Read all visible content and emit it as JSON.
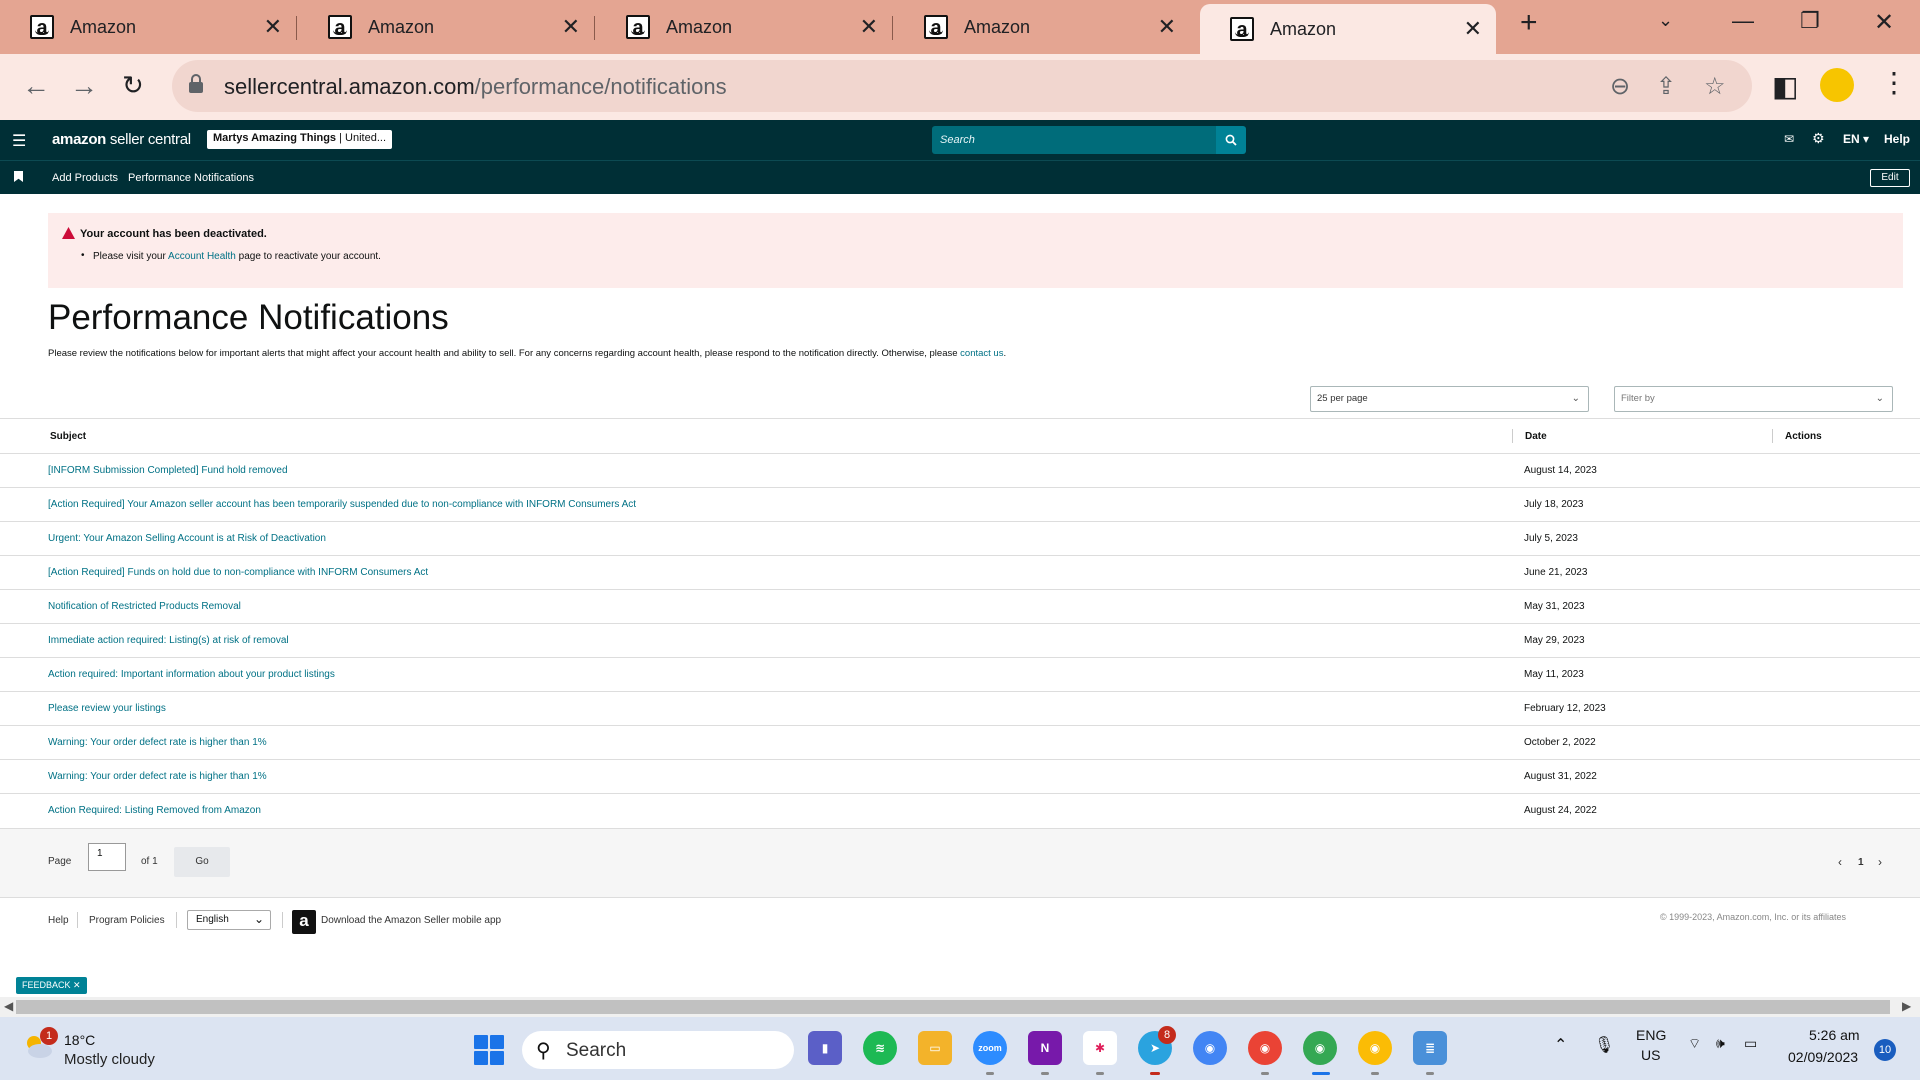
{
  "browser": {
    "tabs": [
      {
        "title": "Amazon",
        "close": "✕"
      },
      {
        "title": "Amazon",
        "close": "✕"
      },
      {
        "title": "Amazon",
        "close": "✕"
      },
      {
        "title": "Amazon",
        "close": "✕"
      },
      {
        "title": "Amazon",
        "close": "✕"
      }
    ],
    "new_tab": "+",
    "url_domain": "sellercentral.amazon.com",
    "url_path": "/performance/notifications"
  },
  "header": {
    "logo_bold": "amazon",
    "logo_rest": " seller central",
    "store_name": "Martys Amazing Things",
    "store_region": " | United...",
    "search_placeholder": "Search",
    "language": "EN ▾",
    "help": "Help"
  },
  "subnav": {
    "links": [
      "Add Products",
      "Performance Notifications"
    ],
    "edit": "Edit"
  },
  "alert": {
    "title": "Your account has been deactivated.",
    "body_pre": "Please visit your ",
    "body_link": "Account Health",
    "body_post": " page to reactivate your account."
  },
  "page": {
    "title": "Performance Notifications",
    "desc_pre": "Please review the notifications below for important alerts that might affect your account health and ability to sell. For any concerns regarding account health, please respond to the notification directly. Otherwise, please ",
    "desc_link": "contact us",
    "desc_post": "."
  },
  "filters": {
    "per_page": "25 per page",
    "filter_placeholder": "Filter by"
  },
  "table": {
    "headers": {
      "subject": "Subject",
      "date": "Date",
      "actions": "Actions"
    },
    "rows": [
      {
        "subject": "[INFORM Submission Completed] Fund hold removed",
        "date": "August 14, 2023"
      },
      {
        "subject": "[Action Required] Your Amazon seller account has been temporarily suspended due to non-compliance with INFORM Consumers Act",
        "date": "July 18, 2023"
      },
      {
        "subject": "Urgent: Your Amazon Selling Account is at Risk of Deactivation",
        "date": "July 5, 2023"
      },
      {
        "subject": "[Action Required] Funds on hold due to non-compliance with INFORM Consumers Act",
        "date": "June 21, 2023"
      },
      {
        "subject": "Notification of Restricted Products Removal",
        "date": "May 31, 2023"
      },
      {
        "subject": "Immediate action required: Listing(s) at risk of removal",
        "date": "May 29, 2023"
      },
      {
        "subject": "Action required: Important information about your product listings",
        "date": "May 11, 2023"
      },
      {
        "subject": "Please review your listings",
        "date": "February 12, 2023"
      },
      {
        "subject": "Warning: Your order defect rate is higher than 1%",
        "date": "October 2, 2022"
      },
      {
        "subject": "Warning: Your order defect rate is higher than 1%",
        "date": "August 31, 2022"
      },
      {
        "subject": "Action Required: Listing Removed from Amazon",
        "date": "August 24, 2022"
      }
    ]
  },
  "pager": {
    "page_label": "Page",
    "page_value": "1",
    "of_label": "of 1",
    "go": "Go",
    "prev": "‹",
    "current": "1",
    "next": "›"
  },
  "footer": {
    "help": "Help",
    "program_policies": "Program Policies",
    "language": "English",
    "download_app": "Download the Amazon Seller mobile app",
    "copyright": "© 1999-2023, Amazon.com, Inc. or its affiliates"
  },
  "feedback": "FEEDBACK ✕",
  "taskbar": {
    "weather_temp": "18°C",
    "weather_condition": "Mostly cloudy",
    "weather_badge": "1",
    "search_label": "Search",
    "telegram_badge": "8",
    "lang_top": "ENG",
    "lang_bottom": "US",
    "time": "5:26 am",
    "date": "02/09/2023",
    "notifications": "10"
  },
  "colors": {
    "tab_strip": "#e4a592",
    "sc_header": "#002f36",
    "link": "#007185",
    "alert_bg": "#fdeceb",
    "alert_icon": "#cc0c39"
  }
}
